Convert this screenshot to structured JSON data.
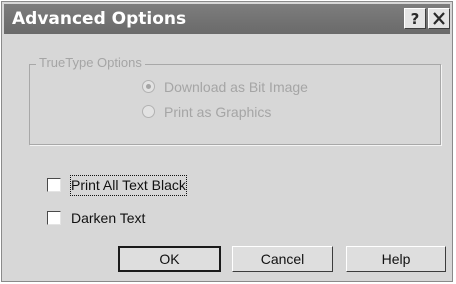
{
  "window": {
    "title": "Advanced Options"
  },
  "titlebar": {
    "help_icon": "question-mark-icon",
    "close_icon": "close-icon"
  },
  "truetype_group": {
    "label": "TrueType Options",
    "options": [
      {
        "label": "Download as Bit Image",
        "selected": true,
        "enabled": false
      },
      {
        "label": "Print as Graphics",
        "selected": false,
        "enabled": false
      }
    ]
  },
  "checkboxes": {
    "print_all_black": {
      "label": "Print All Text Black",
      "checked": false
    },
    "darken_text": {
      "label": "Darken Text",
      "checked": false
    }
  },
  "buttons": {
    "ok": "OK",
    "cancel": "Cancel",
    "help": "Help"
  }
}
